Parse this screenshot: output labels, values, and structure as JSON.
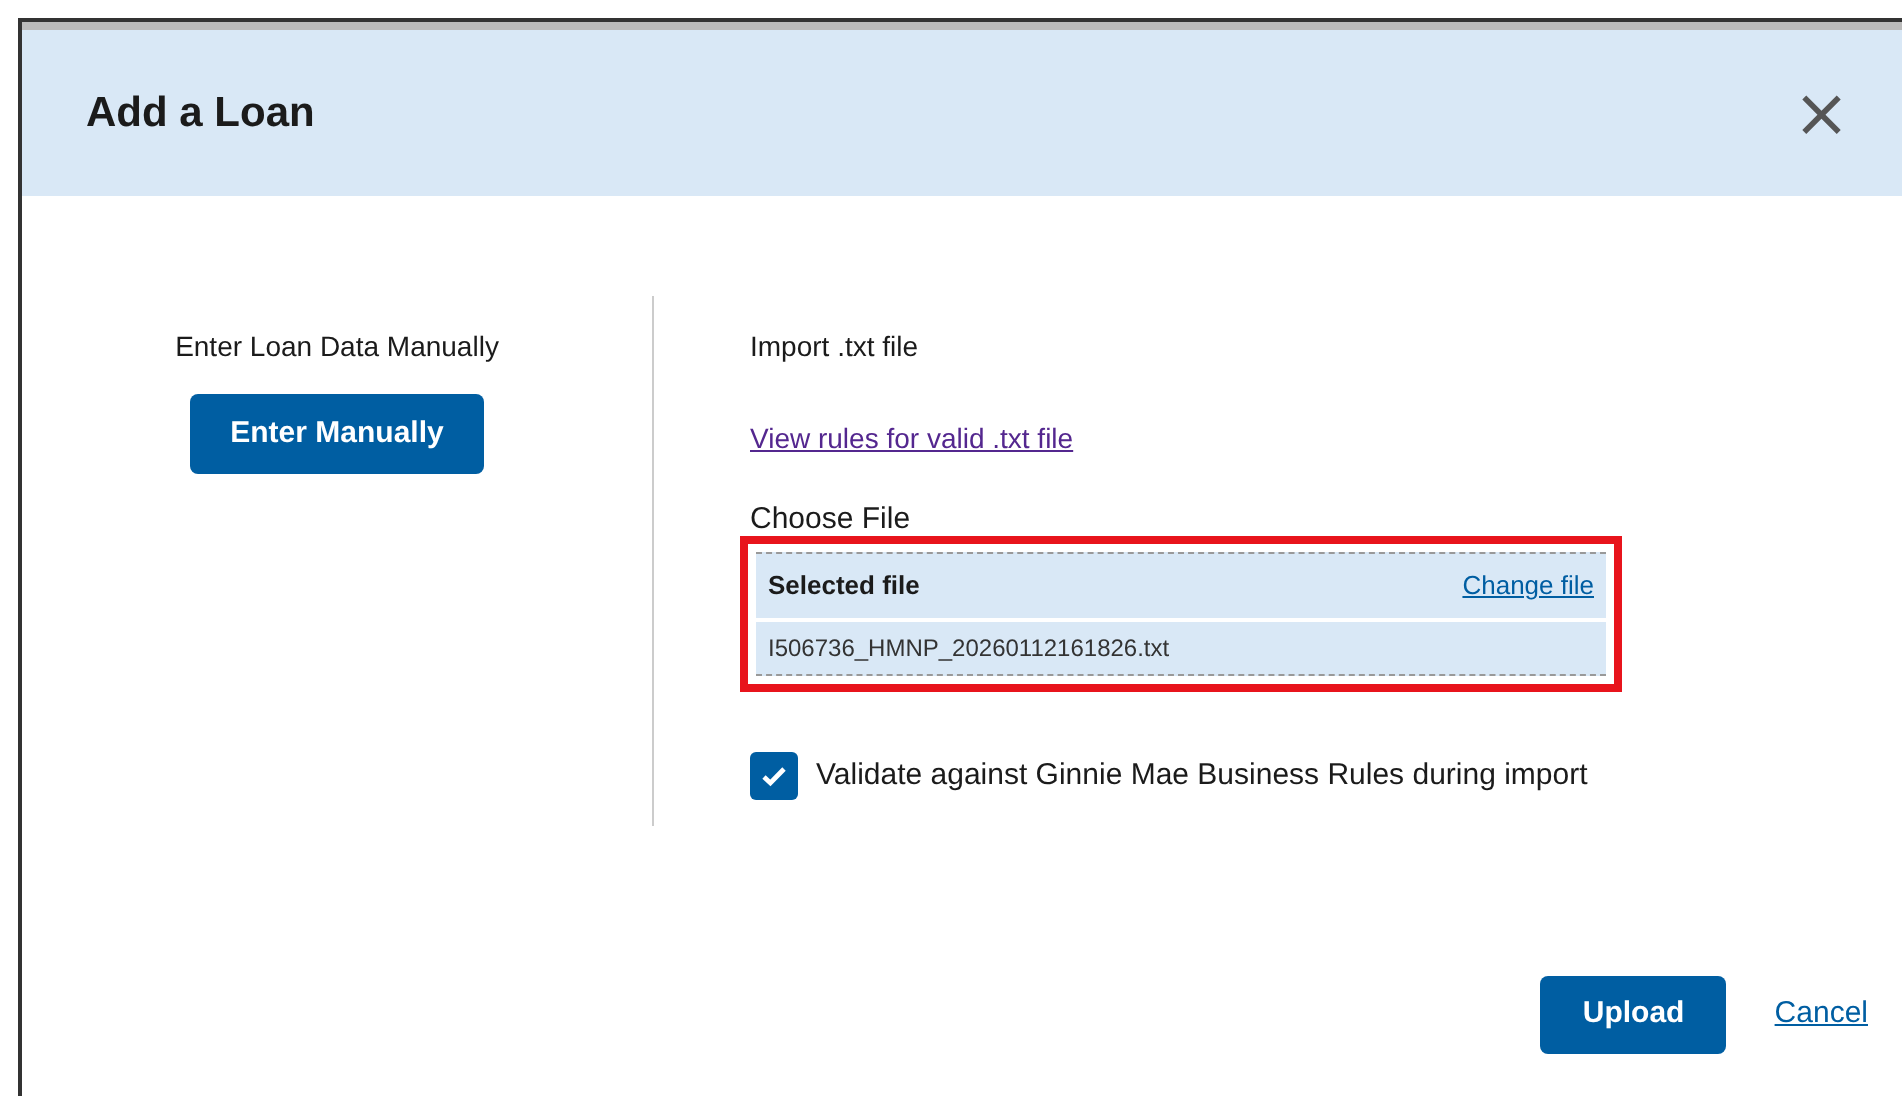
{
  "dialog": {
    "title": "Add a Loan",
    "close": "×"
  },
  "manual": {
    "label": "Enter Loan Data Manually",
    "button": "Enter Manually"
  },
  "import": {
    "heading": "Import .txt file",
    "rules_link": "View rules for valid .txt file",
    "choose_label": "Choose File",
    "selected_label": "Selected file",
    "change_link": "Change file",
    "file_name": "I506736_HMNP_20260112161826.txt",
    "highlighted": true
  },
  "validate": {
    "label": "Validate against Ginnie Mae Business Rules during import",
    "checked": true
  },
  "buttons": {
    "upload": "Upload",
    "cancel": "Cancel"
  }
}
